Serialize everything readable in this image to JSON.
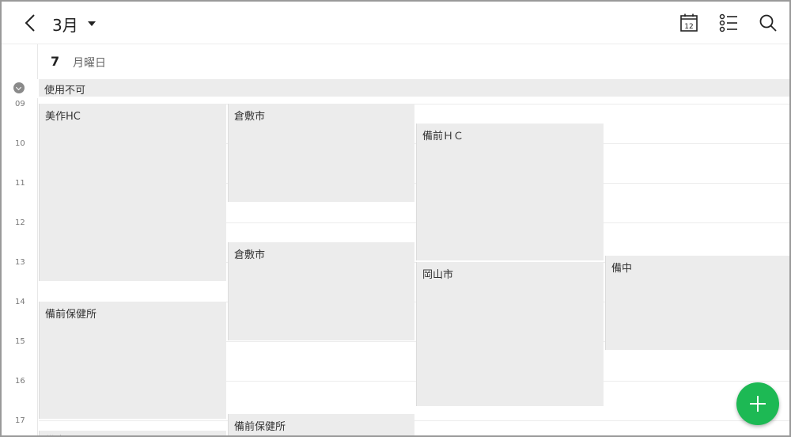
{
  "header": {
    "month": "3月",
    "back_icon": "chevron-left-icon",
    "calendar_icon_day": "12",
    "icons": [
      "calendar-today-icon",
      "task-list-icon",
      "search-icon"
    ]
  },
  "day": {
    "number": "7",
    "weekday": "月曜日"
  },
  "all_day": {
    "collapse_icon": "chevron-down-icon",
    "event": "使用不可"
  },
  "hours": [
    "09",
    "10",
    "11",
    "12",
    "13",
    "14",
    "15",
    "16",
    "17"
  ],
  "events": [
    {
      "title": "美作HC"
    },
    {
      "title": "倉敷市"
    },
    {
      "title": "備前ＨＣ"
    },
    {
      "title": "倉敷市"
    },
    {
      "title": "岡山市"
    },
    {
      "title": "備中"
    },
    {
      "title": "備前保健所"
    },
    {
      "title": "備前保健所"
    },
    {
      "title": "備中"
    }
  ],
  "fab": {
    "icon": "plus-icon"
  },
  "colors": {
    "accent": "#1db954",
    "event_bg": "#ececec"
  }
}
